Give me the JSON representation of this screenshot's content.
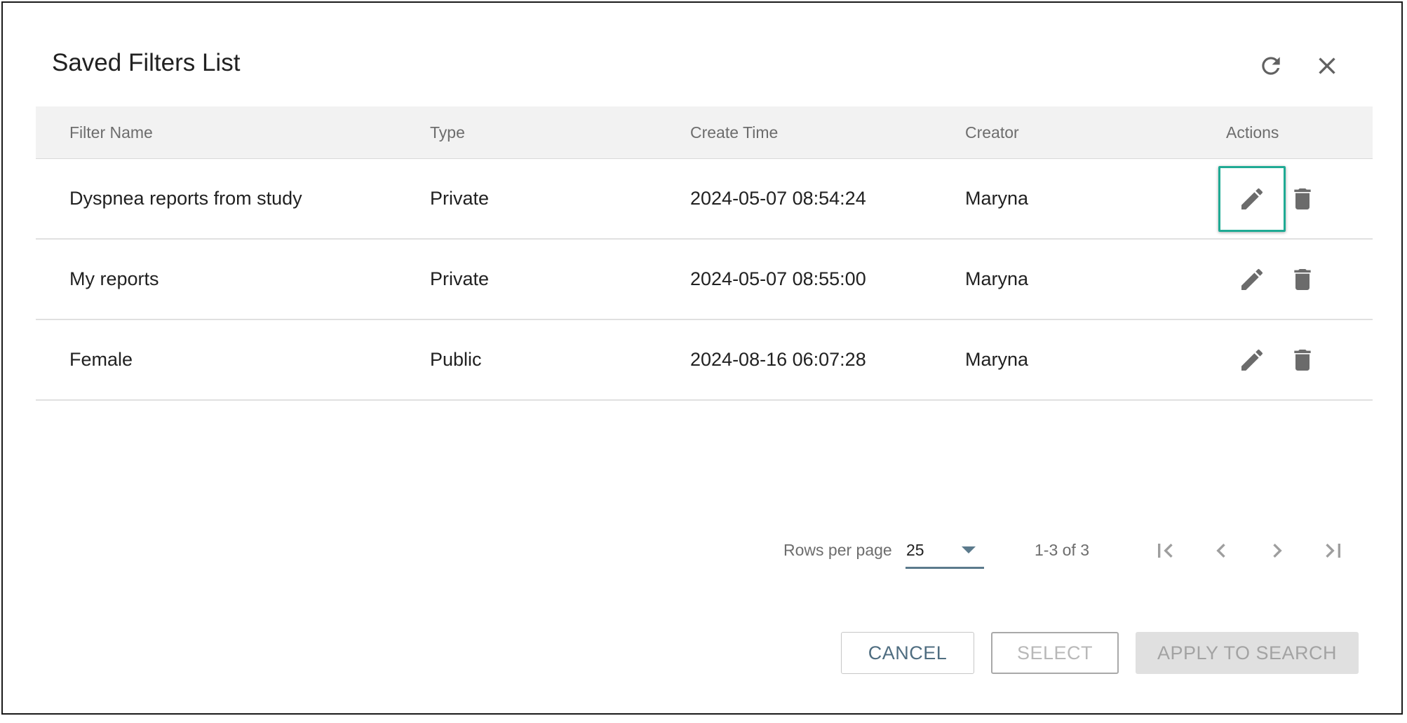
{
  "dialog": {
    "title": "Saved Filters List",
    "icons": {
      "refresh": "refresh-icon",
      "close": "close-icon"
    }
  },
  "table": {
    "headers": {
      "name": "Filter Name",
      "type": "Type",
      "time": "Create Time",
      "creator": "Creator",
      "actions": "Actions"
    },
    "rows": [
      {
        "name": "Dyspnea reports from study",
        "type": "Private",
        "time": "2024-05-07 08:54:24",
        "creator": "Maryna"
      },
      {
        "name": "My reports",
        "type": "Private",
        "time": "2024-05-07 08:55:00",
        "creator": "Maryna"
      },
      {
        "name": "Female",
        "type": "Public",
        "time": "2024-08-16 06:07:28",
        "creator": "Maryna"
      }
    ],
    "row_action_icons": [
      "pencil-icon",
      "trash-icon"
    ],
    "focused_row": 0
  },
  "pagination": {
    "rows_per_page_label": "Rows per page",
    "rows_per_page_value": "25",
    "range": "1-3 of 3"
  },
  "footer": {
    "cancel": "CANCEL",
    "select": "SELECT",
    "apply": "APPLY TO SEARCH"
  },
  "colors": {
    "focus_border": "#1faa94",
    "primary_text_button": "#4f6d80",
    "disabled_text": "#a3a3a3",
    "header_bg": "#f2f2f2"
  }
}
